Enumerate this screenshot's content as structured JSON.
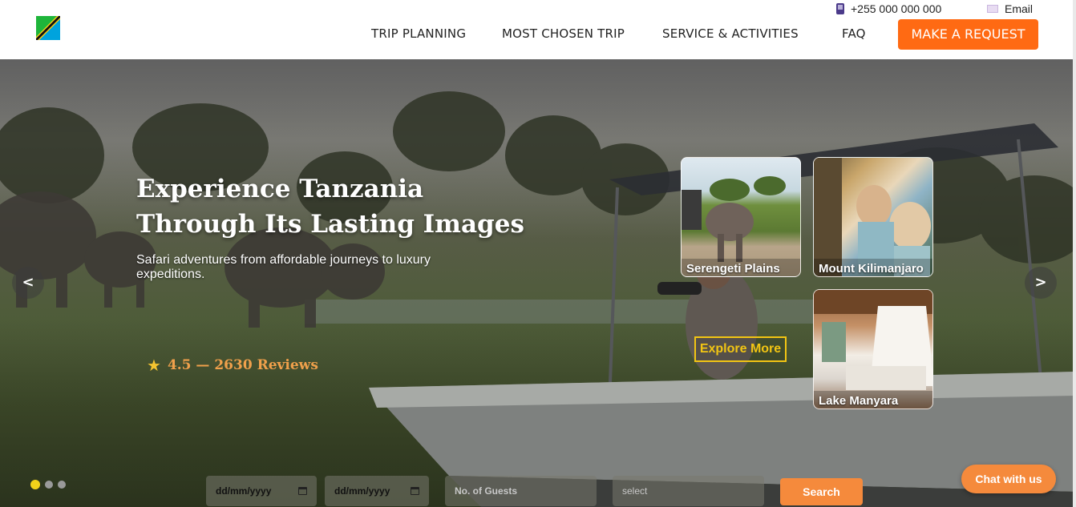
{
  "header": {
    "phone": "+255 000 000 000",
    "email": "Email",
    "nav": {
      "trip_planning": "TRIP PLANNING",
      "most_chosen_trip": "MOST CHOSEN TRIP",
      "service_activities": "SERVICE & ACTIVITIES",
      "faq": "FAQ"
    },
    "cta": "MAKE A REQUEST"
  },
  "hero": {
    "title_line1": "Experience Tanzania",
    "title_line2": "Through Its Lasting Images",
    "subtitle": "Safari adventures from affordable journeys to luxury expeditions.",
    "rating": "4.5 — 2630 Reviews",
    "prev_arrow": "<",
    "next_arrow": ">",
    "explore_label": "Explore More",
    "slides": {
      "total": 3,
      "active": 1
    }
  },
  "destinations": [
    {
      "label": "Serengeti Plains"
    },
    {
      "label": "Mount Kilimanjaro"
    },
    {
      "label": "Lake Manyara"
    }
  ],
  "search": {
    "start_date": "dd/mm/yyyy",
    "end_date": "dd/mm/yyyy",
    "guests_placeholder": "No. of Guests",
    "select_placeholder": "select",
    "search_label": "Search"
  },
  "chat_label": "Chat with us",
  "colors": {
    "accent": "#ff6a13",
    "search_button": "#f58a3c",
    "explore_border": "#f2c513",
    "rating_text": "#f0a04b",
    "active_dot": "#f2d21a"
  },
  "icons": {
    "logo": "tanzania-flag-icon",
    "phone": "phone-icon",
    "email": "mail-icon",
    "star": "star-icon",
    "calendar": "calendar-icon"
  }
}
